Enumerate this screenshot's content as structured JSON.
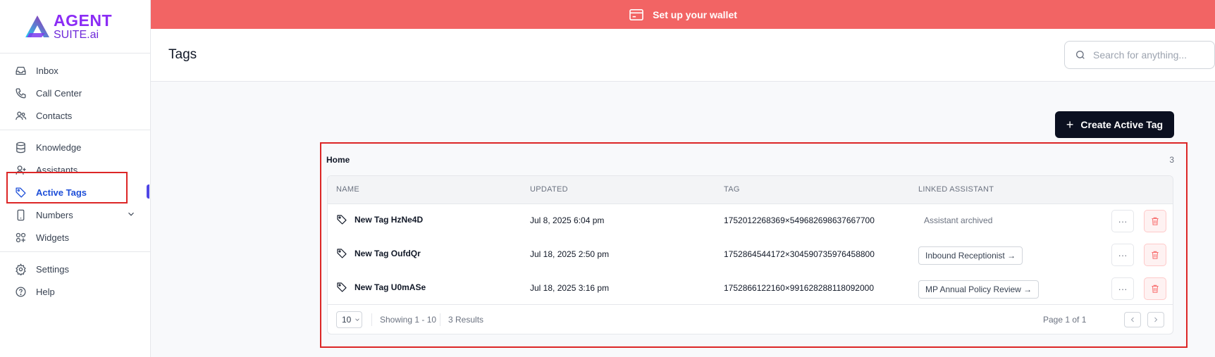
{
  "app": {
    "logo_line1": "AGENT",
    "logo_line2": "SUITE.ai",
    "brand_color": "#8b2cf5"
  },
  "banner": {
    "text": "Set up your wallet",
    "icon": "wallet-card-icon",
    "color": "#f26464"
  },
  "sidebar": {
    "groups": [
      [
        {
          "label": "Inbox",
          "icon": "inbox-icon"
        },
        {
          "label": "Call Center",
          "icon": "phone-icon"
        },
        {
          "label": "Contacts",
          "icon": "contacts-icon"
        }
      ],
      [
        {
          "label": "Knowledge",
          "icon": "database-icon"
        },
        {
          "label": "Assistants",
          "icon": "user-plus-icon"
        },
        {
          "label": "Active Tags",
          "icon": "tag-icon",
          "active": true
        },
        {
          "label": "Numbers",
          "icon": "phone-device-icon",
          "has_children": true
        },
        {
          "label": "Widgets",
          "icon": "widgets-icon"
        }
      ],
      [
        {
          "label": "Settings",
          "icon": "gear-icon"
        },
        {
          "label": "Help",
          "icon": "help-icon"
        }
      ]
    ]
  },
  "header": {
    "title": "Tags",
    "search_placeholder": "Search for anything..."
  },
  "actions": {
    "create_label": "Create Active Tag"
  },
  "card": {
    "title": "Home",
    "count": "3"
  },
  "table": {
    "columns": [
      "NAME",
      "UPDATED",
      "TAG",
      "LINKED ASSISTANT"
    ],
    "rows": [
      {
        "name": "New Tag HzNe4D",
        "updated": "Jul 8, 2025 6:04 pm",
        "tag": "1752012268369×549682698637667700",
        "linked": "Assistant archived",
        "linked_is_link": false
      },
      {
        "name": "New Tag OufdQr",
        "updated": "Jul 18, 2025 2:50 pm",
        "tag": "1752864544172×304590735976458800",
        "linked": "Inbound Receptionist →",
        "linked_is_link": true
      },
      {
        "name": "New Tag U0mASe",
        "updated": "Jul 18, 2025 3:16 pm",
        "tag": "1752866122160×991628288118092000",
        "linked": "MP Annual Policy Review →",
        "linked_is_link": true
      }
    ],
    "more_label": "···"
  },
  "pagination": {
    "page_size": "10",
    "showing": "Showing 1 - 10",
    "results": "3 Results",
    "page": "Page 1 of 1"
  }
}
